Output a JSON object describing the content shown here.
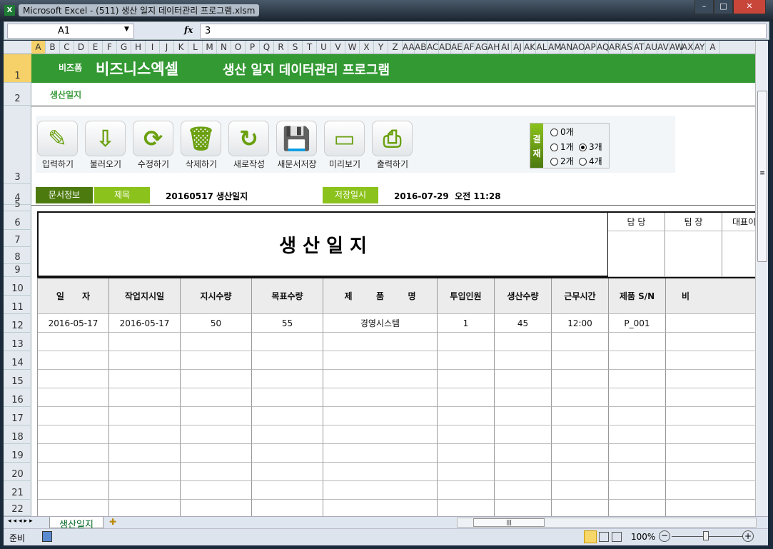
{
  "window": {
    "title": "Microsoft Excel - (511) 생산 일지 데이터관리 프로그램.xlsm",
    "minimize": "–",
    "maximize": "□",
    "close": "✕"
  },
  "formula_bar": {
    "name_box": "A1",
    "fx": "fx",
    "value": "3"
  },
  "columns": [
    "A",
    "B",
    "C",
    "D",
    "E",
    "F",
    "G",
    "H",
    "I",
    "J",
    "K",
    "L",
    "M",
    "N",
    "O",
    "P",
    "Q",
    "R",
    "S",
    "T",
    "U",
    "V",
    "W",
    "X",
    "Y",
    "Z",
    "AA",
    "AB",
    "AC",
    "AD",
    "AE",
    "AF",
    "AG",
    "AH",
    "AI",
    "AJ",
    "AK",
    "AL",
    "AM",
    "AN",
    "AO",
    "AP",
    "AQ",
    "AR",
    "AS",
    "AT",
    "AU",
    "AV",
    "AW",
    "AX",
    "AY",
    "A"
  ],
  "rows": [
    "1",
    "2",
    "3",
    "4",
    "5",
    "6",
    "7",
    "8",
    "9",
    "10",
    "11",
    "12",
    "13",
    "14",
    "15",
    "16",
    "17",
    "18",
    "19",
    "20",
    "21",
    "22"
  ],
  "banner": {
    "brand_small": "비즈폼",
    "brand": "비즈니스엑셀",
    "title": "생산 일지 데이터관리 프로그램"
  },
  "subtitle": "생산일지",
  "toolbar": [
    {
      "label": "입력하기",
      "icon": "pencil-icon"
    },
    {
      "label": "불러오기",
      "icon": "load-icon"
    },
    {
      "label": "수정하기",
      "icon": "refresh-icon"
    },
    {
      "label": "삭제하기",
      "icon": "trash-icon"
    },
    {
      "label": "새로작성",
      "icon": "new-icon"
    },
    {
      "label": "새문서저장",
      "icon": "save-icon"
    },
    {
      "label": "미리보기",
      "icon": "monitor-icon"
    },
    {
      "label": "출력하기",
      "icon": "print-icon"
    }
  ],
  "approval": {
    "label1": "결",
    "label2": "재",
    "options": [
      "0개",
      "1개",
      "3개",
      "2개",
      "4개"
    ],
    "selected": "3개"
  },
  "doc_info": {
    "label": "문서정보",
    "title_label": "제목",
    "title_value": "20160517 생산일지",
    "saved_label": "저장일시",
    "saved_value": "2016-07-29  오전 11:28"
  },
  "form": {
    "title": "생 산 일 지",
    "signers": [
      "담 당",
      "팀 장",
      "대표이"
    ]
  },
  "table": {
    "headers": [
      "일      자",
      "작업지시일",
      "지시수량",
      "목표수량",
      "제        품        명",
      "투입인원",
      "생산수량",
      "근무시간",
      "제품 S/N",
      "비"
    ],
    "rows": [
      [
        "2016-05-17",
        "2016-05-17",
        "50",
        "55",
        "경영시스템",
        "1",
        "45",
        "12:00",
        "P_001",
        ""
      ]
    ]
  },
  "sheet_tab": "생산일지",
  "status": {
    "ready": "준비",
    "zoom": "100%"
  },
  "colors": {
    "banner": "#339933",
    "dark_green": "#4d7a0f",
    "light_green": "#8cc21c"
  }
}
